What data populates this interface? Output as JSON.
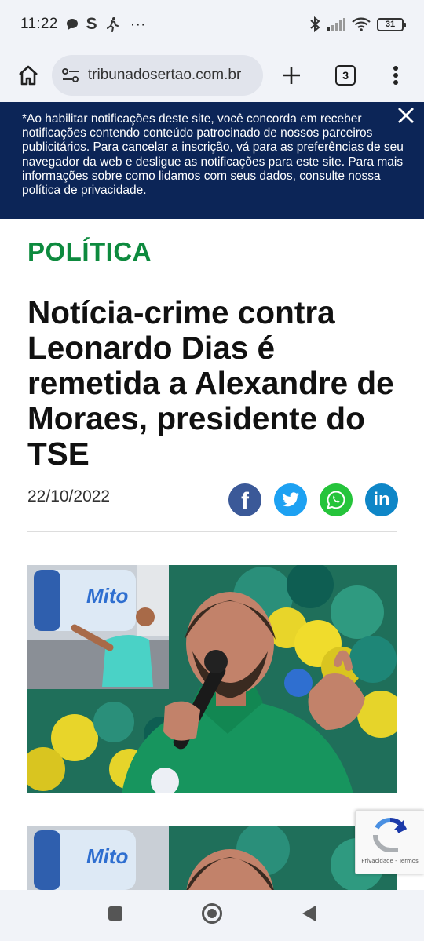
{
  "status_bar": {
    "time": "11:22",
    "letter": "S",
    "dots": "···",
    "battery": "31"
  },
  "browser": {
    "url": "tribunadosertao.com.br",
    "tab_count": "3"
  },
  "notice": {
    "text": "*Ao habilitar notificações deste site, você concorda em receber notificações contendo conteúdo patrocinado de nossos parceiros publicitários. Para cancelar a inscrição, vá para as preferências de seu navegador da web e desligue as notificações para este site. Para mais informações sobre como lidamos com seus dados, consulte nossa política de privacidade."
  },
  "article": {
    "category": "POLÍTICA",
    "headline": "Notícia-crime contra Leonardo Dias é remetida a Alexandre de Moraes, presidente do TSE",
    "date": "22/10/2022",
    "share": [
      {
        "name": "facebook",
        "color": "#3b5998",
        "glyph": "f"
      },
      {
        "name": "twitter",
        "color": "#1da1f2"
      },
      {
        "name": "whatsapp",
        "color": "#25c43b"
      },
      {
        "name": "linkedin",
        "color": "#0e86c7",
        "glyph": "in"
      }
    ],
    "photo_can_text": "Mito"
  },
  "recaptcha": {
    "footer": "Privacidade - Termos"
  },
  "colors": {
    "category": "#0d8a3e",
    "notice_bg": "#0c2557",
    "chrome_bg": "#f1f3f8"
  }
}
